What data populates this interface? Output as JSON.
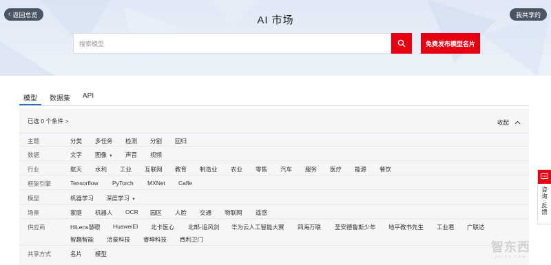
{
  "header": {
    "back_label": "返回总览",
    "title": "AI 市场",
    "share_label": "我共享的",
    "search_placeholder": "搜索模型",
    "publish_label": "免费发布模型名片"
  },
  "tabs": [
    {
      "label": "模型",
      "active": true
    },
    {
      "label": "数据集",
      "active": false
    },
    {
      "label": "API",
      "active": false
    }
  ],
  "filter": {
    "selected_text": "已选 0 个条件 >",
    "collapse_label": "收起",
    "rows": [
      {
        "label": "主题",
        "options": [
          "分类",
          "多任务",
          "检测",
          "分割",
          "回归"
        ]
      },
      {
        "label": "数据",
        "options": [
          "文字",
          "图像",
          "声音",
          "视频"
        ]
      },
      {
        "label": "行业",
        "options": [
          "航天",
          "水利",
          "工业",
          "互联网",
          "教育",
          "制造业",
          "农业",
          "零售",
          "汽车",
          "服务",
          "医疗",
          "能源",
          "餐饮"
        ]
      },
      {
        "label": "框架引擎",
        "options": [
          "Tensorflow",
          "PyTorch",
          "MXNet",
          "Caffe"
        ]
      },
      {
        "label": "模型",
        "options": [
          "机器学习",
          "深度学习"
        ]
      },
      {
        "label": "场景",
        "options": [
          "家庭",
          "机器人",
          "OCR",
          "园区",
          "人脸",
          "交通",
          "物联网",
          "遥感"
        ]
      },
      {
        "label": "供应商",
        "options": [
          "HiLens慧眼",
          "HuaweiEI",
          "北卡医心",
          "北邮-追风剑",
          "华为云人工智能大赛",
          "四海万联",
          "圣安德鲁斯少年",
          "地平教书先生",
          "工业君",
          "广联达",
          "智趣智能",
          "洽豪科技",
          "睿坤科技",
          "西利卫门"
        ]
      },
      {
        "label": "共享方式",
        "options": [
          "名片",
          "模型"
        ]
      }
    ]
  },
  "float_panel": {
    "label": "咨询·反馈"
  },
  "watermark": {
    "text": "智东西",
    "sub": "ZHIDX.COM"
  },
  "colors": {
    "accent_red": "#e60012",
    "tab_blue": "#2f6bc4",
    "dark_pill": "#4a5564"
  }
}
